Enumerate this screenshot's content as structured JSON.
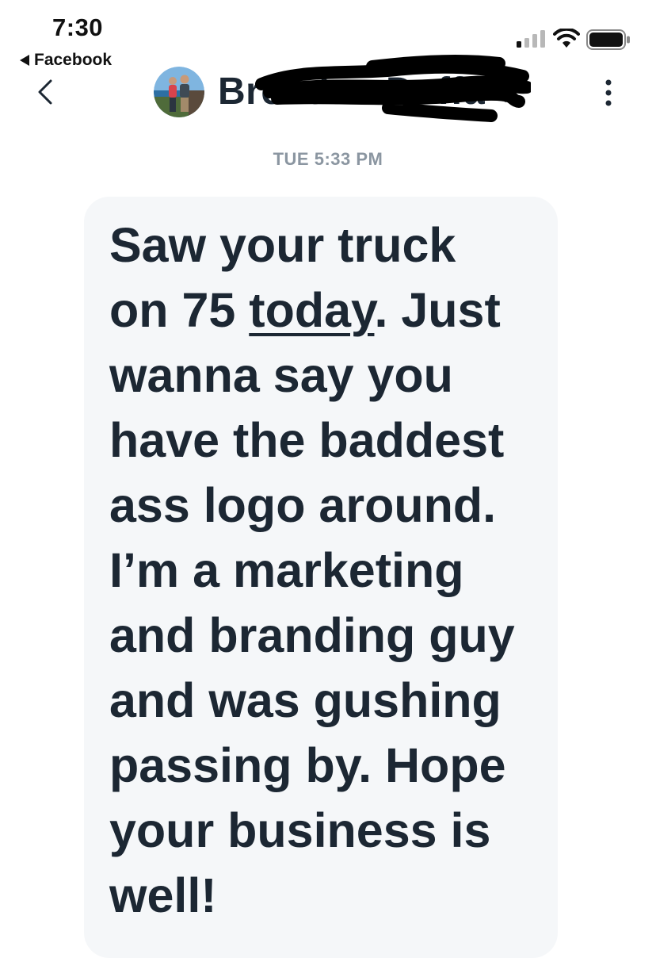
{
  "status_bar": {
    "time": "7:30",
    "back_app_label": "Facebook"
  },
  "header": {
    "contact_name": "Brendan Duffa",
    "contact_suffix": "$"
  },
  "conversation": {
    "timestamp": "TUE 5:33 PM",
    "message": {
      "line1": "Saw your truck",
      "line2_before": "on 75 ",
      "line2_link": "today",
      "line2_after": ". Just",
      "line3": "wanna say you",
      "line4": "have the baddest",
      "line5": "ass logo around.",
      "line6": "I’m a marketing",
      "line7": "and branding guy",
      "line8": "and was gushing",
      "line9": "passing by. Hope",
      "line10": "your business is",
      "line11": "well!"
    }
  },
  "icons": {
    "back": "chevron-left-icon",
    "menu": "more-vertical-icon",
    "signal": "cellular-signal-icon",
    "wifi": "wifi-icon",
    "battery": "battery-icon"
  },
  "colors": {
    "text": "#1c2733",
    "timestamp": "#8b96a1",
    "bubble": "#f5f7f9"
  }
}
